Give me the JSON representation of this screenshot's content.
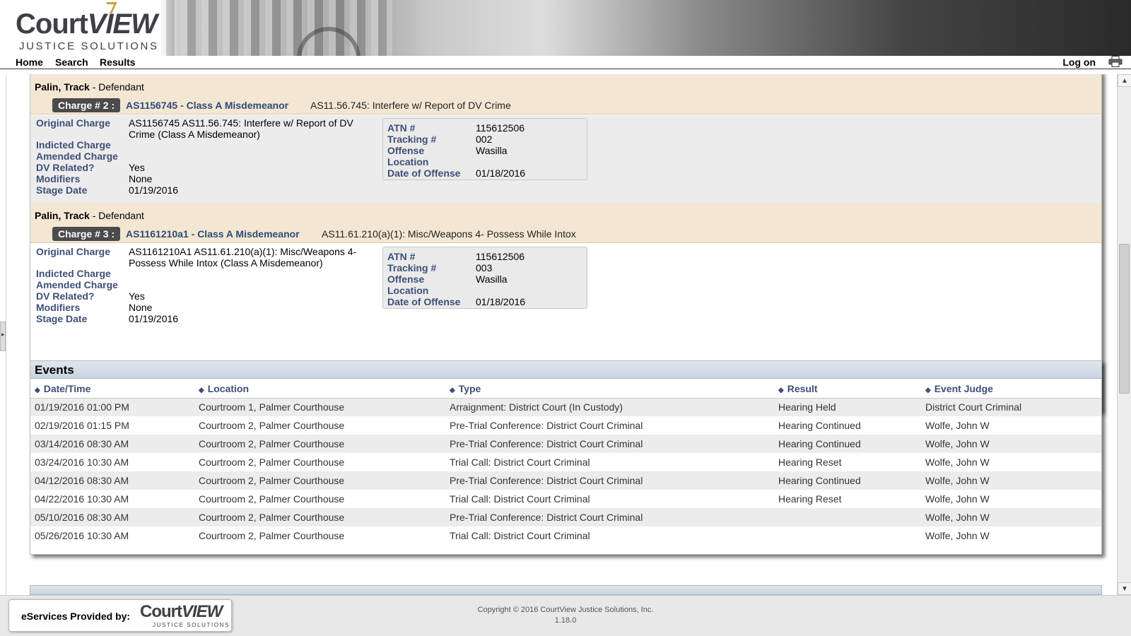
{
  "header": {
    "logo_main": "Court",
    "logo_view": "VIEW",
    "logo_tagline": "JUSTICE SOLUTIONS"
  },
  "nav": {
    "home": "Home",
    "search": "Search",
    "results": "Results",
    "logon": "Log on"
  },
  "charges": [
    {
      "party_name": "Palin, Track",
      "party_role": " - Defendant",
      "badge": "Charge # 2 :",
      "code": "AS1156745 - Class A Misdemeanor",
      "description": "AS11.56.745: Interfere w/ Report of DV Crime",
      "labels": {
        "original": "Original Charge",
        "indicted": "Indicted Charge",
        "amended": "Amended Charge",
        "dv": "DV Related?",
        "modifiers": "Modifiers",
        "stage": "Stage Date"
      },
      "original_charge": "AS1156745 AS11.56.745: Interfere w/ Report of DV Crime (Class A Misdemeanor)",
      "dv_related": "Yes",
      "modifiers": "None",
      "stage_date": "01/19/2016",
      "info_labels": {
        "atn": "ATN #",
        "tracking": "Tracking #",
        "offense_location_1": "Offense",
        "offense_location_2": "Location",
        "date_of_offense": "Date of Offense"
      },
      "atn": "115612506",
      "tracking": "002",
      "offense_location": "Wasilla",
      "date_of_offense": "01/18/2016"
    },
    {
      "party_name": "Palin, Track",
      "party_role": " - Defendant",
      "badge": "Charge # 3 :",
      "code": "AS1161210a1 - Class A Misdemeanor",
      "description": "AS11.61.210(a)(1): Misc/Weapons 4- Possess While Intox",
      "labels": {
        "original": "Original Charge",
        "indicted": "Indicted Charge",
        "amended": "Amended Charge",
        "dv": "DV Related?",
        "modifiers": "Modifiers",
        "stage": "Stage Date"
      },
      "original_charge": "AS1161210A1 AS11.61.210(a)(1): Misc/Weapons 4- Possess While Intox (Class A Misdemeanor)",
      "dv_related": "Yes",
      "modifiers": "None",
      "stage_date": "01/19/2016",
      "info_labels": {
        "atn": "ATN #",
        "tracking": "Tracking #",
        "offense_location_1": "Offense",
        "offense_location_2": "Location",
        "date_of_offense": "Date of Offense"
      },
      "atn": "115612506",
      "tracking": "003",
      "offense_location": "Wasilla",
      "date_of_offense": "01/18/2016"
    }
  ],
  "events": {
    "title": "Events",
    "columns": [
      "Date/Time",
      "Location",
      "Type",
      "Result",
      "Event Judge"
    ],
    "rows": [
      [
        "01/19/2016 01:00 PM",
        "Courtroom 1, Palmer Courthouse",
        "Arraignment: District Court (In Custody)",
        "Hearing Held",
        "District Court Criminal"
      ],
      [
        "02/19/2016 01:15 PM",
        "Courtroom 2, Palmer Courthouse",
        "Pre-Trial Conference: District Court Criminal",
        "Hearing Continued",
        "Wolfe, John W"
      ],
      [
        "03/14/2016 08:30 AM",
        "Courtroom 2, Palmer Courthouse",
        "Pre-Trial Conference: District Court Criminal",
        "Hearing Continued",
        "Wolfe, John W"
      ],
      [
        "03/24/2016 10:30 AM",
        "Courtroom 2, Palmer Courthouse",
        "Trial Call: District Court Criminal",
        "Hearing Reset",
        "Wolfe, John W"
      ],
      [
        "04/12/2016 08:30 AM",
        "Courtroom 2, Palmer Courthouse",
        "Pre-Trial Conference: District Court Criminal",
        "Hearing Continued",
        "Wolfe, John W"
      ],
      [
        "04/22/2016 10:30 AM",
        "Courtroom 2, Palmer Courthouse",
        "Trial Call: District Court Criminal",
        "Hearing Reset",
        "Wolfe, John W"
      ],
      [
        "05/10/2016 08:30 AM",
        "Courtroom 2, Palmer Courthouse",
        "Pre-Trial Conference: District Court Criminal",
        "",
        "Wolfe, John W"
      ],
      [
        "05/26/2016 10:30 AM",
        "Courtroom 2, Palmer Courthouse",
        "Trial Call: District Court Criminal",
        "",
        "Wolfe, John W"
      ]
    ]
  },
  "footer": {
    "provided_by": "eServices Provided by:",
    "logo_main": "Court",
    "logo_view": "VIEW",
    "logo_tagline": "JUSTICE SOLUTIONS",
    "copyright": "Copyright © 2016 CourtView Justice Solutions, Inc.",
    "version": "1.18.0"
  },
  "colors": {
    "charge_header_bg": "#f3e7d3",
    "label_blue": "#3d4f78",
    "charge_code_blue": "#2d4a7a",
    "badge_bg": "#4b4b4b"
  }
}
